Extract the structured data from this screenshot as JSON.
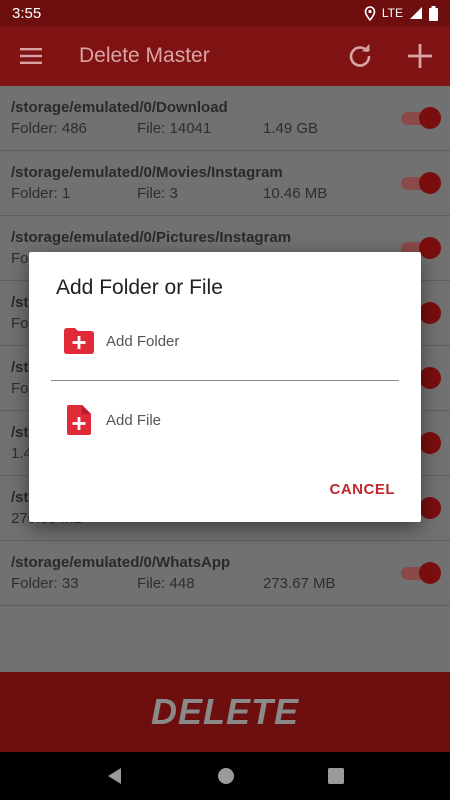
{
  "status_bar": {
    "time": "3:55",
    "network": "LTE"
  },
  "app_bar": {
    "title": "Delete Master"
  },
  "list": [
    {
      "path": "/storage/emulated/0/Download",
      "folder": "Folder: 486",
      "file": "File: 14041",
      "size": "1.49 GB",
      "enabled": true
    },
    {
      "path": "/storage/emulated/0/Movies/Instagram",
      "folder": "Folder: 1",
      "file": "File: 3",
      "size": "10.46 MB",
      "enabled": true
    },
    {
      "path": "/storage/emulated/0/Pictures/Instagram",
      "folder": "Fo",
      "file": "",
      "size": "",
      "enabled": true
    },
    {
      "path": "/st",
      "folder": "Fo",
      "file": "",
      "size": "",
      "enabled": true
    },
    {
      "path": "/st",
      "folder": "Fo",
      "file": "",
      "size": "",
      "enabled": true
    },
    {
      "path": "/st",
      "folder": "1.4",
      "file": "",
      "size": "",
      "enabled": true
    },
    {
      "path": "/st",
      "folder": "270.85 MB",
      "file": "",
      "size": "",
      "enabled": true
    },
    {
      "path": "/storage/emulated/0/WhatsApp",
      "folder": "Folder: 33",
      "file": "File: 448",
      "size": "273.67 MB",
      "enabled": true
    }
  ],
  "delete_button": {
    "label": "DELETE"
  },
  "dialog": {
    "title": "Add Folder or File",
    "add_folder": "Add Folder",
    "add_file": "Add File",
    "cancel": "CANCEL"
  },
  "colors": {
    "accent": "#c1272d",
    "app_bar": "#7f1313"
  },
  "icons": {
    "menu": "hamburger-menu-icon",
    "refresh": "refresh-icon",
    "add": "plus-icon",
    "add_folder": "folder-plus-icon",
    "add_file": "file-plus-icon"
  }
}
